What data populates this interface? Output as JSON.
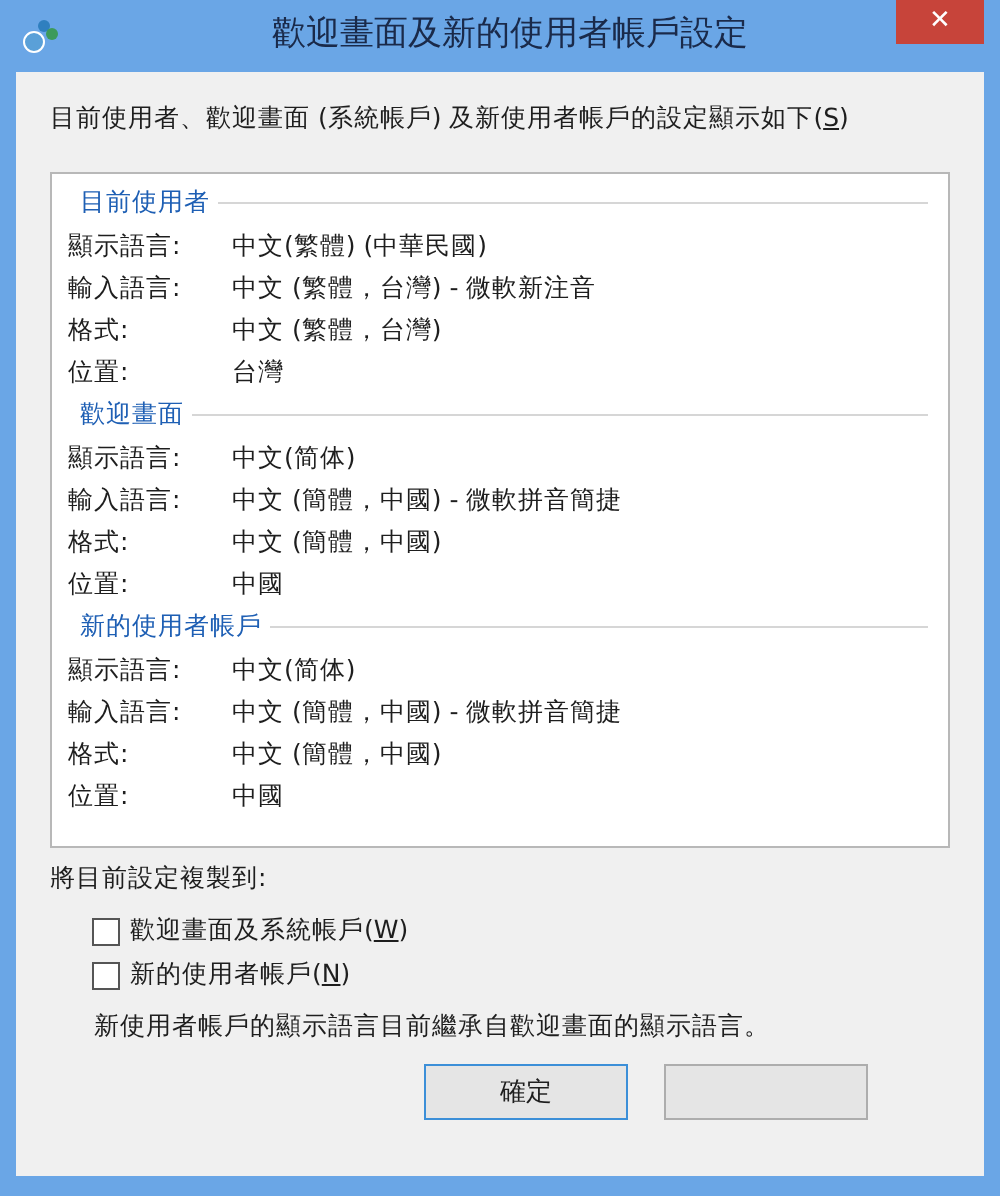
{
  "window": {
    "title": "歡迎畫面及新的使用者帳戶設定",
    "close": "✕"
  },
  "intro": {
    "text": "目前使用者、歡迎畫面 (系統帳戶) 及新使用者帳戶的設定顯示如下(",
    "accel": "S",
    "after": ")"
  },
  "groups": [
    {
      "title": "目前使用者",
      "rows": [
        {
          "label": "顯示語言:",
          "value": "中文(繁體) (中華民國)"
        },
        {
          "label": "輸入語言:",
          "value": "中文 (繁體，台灣) - 微軟新注音"
        },
        {
          "label": "格式:",
          "value": "中文 (繁體，台灣)"
        },
        {
          "label": "位置:",
          "value": "台灣"
        }
      ]
    },
    {
      "title": "歡迎畫面",
      "rows": [
        {
          "label": "顯示語言:",
          "value": "中文(简体)"
        },
        {
          "label": "輸入語言:",
          "value": "中文 (簡體，中國) - 微軟拼音簡捷"
        },
        {
          "label": "格式:",
          "value": "中文 (簡體，中國)"
        },
        {
          "label": "位置:",
          "value": "中國"
        }
      ]
    },
    {
      "title": "新的使用者帳戶",
      "rows": [
        {
          "label": "顯示語言:",
          "value": "中文(简体)"
        },
        {
          "label": "輸入語言:",
          "value": "中文 (簡體，中國) - 微軟拼音簡捷"
        },
        {
          "label": "格式:",
          "value": "中文 (簡體，中國)"
        },
        {
          "label": "位置:",
          "value": "中國"
        }
      ]
    }
  ],
  "copy_label": "將目前設定複製到:",
  "checkboxes": [
    {
      "text": "歡迎畫面及系統帳戶(",
      "accel": "W",
      "after": ")",
      "checked": false
    },
    {
      "text": "新的使用者帳戶(",
      "accel": "N",
      "after": ")",
      "checked": false
    }
  ],
  "note": "新使用者帳戶的顯示語言目前繼承自歡迎畫面的顯示語言。",
  "buttons": [
    {
      "label": "確定",
      "kind": "default"
    },
    {
      "kind": "hidden"
    }
  ]
}
